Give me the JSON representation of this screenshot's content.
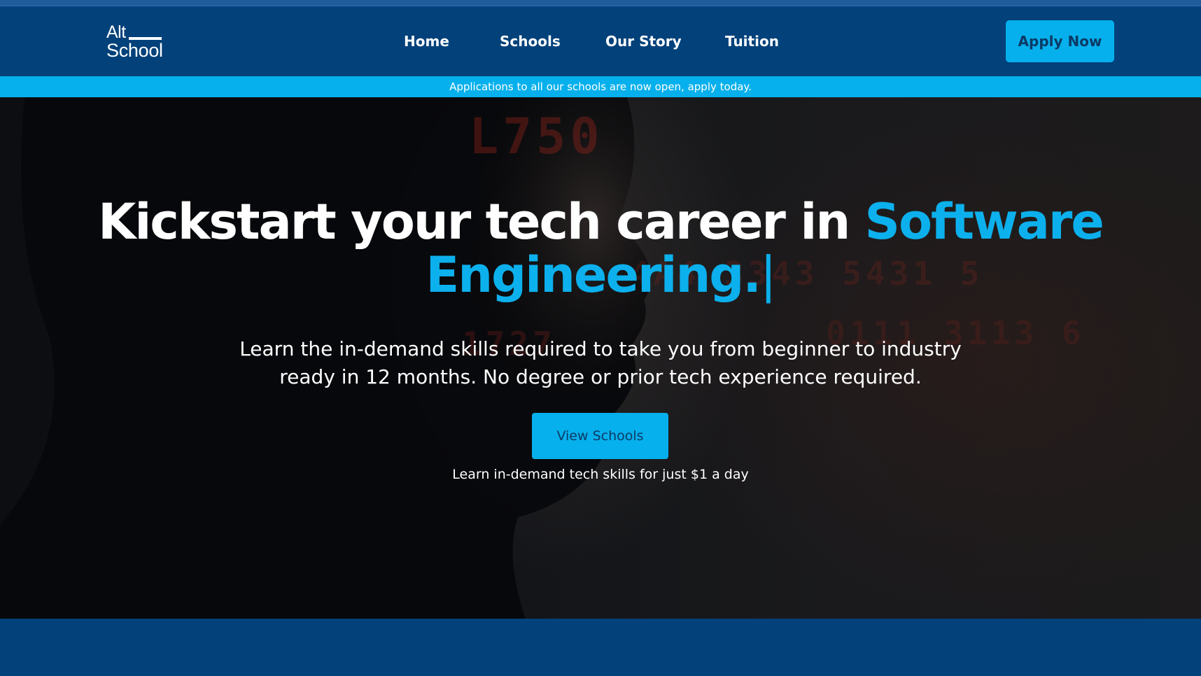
{
  "brand": {
    "logo_line1": "Alt",
    "logo_line2": "School"
  },
  "nav": {
    "items": [
      {
        "label": "Home"
      },
      {
        "label": "Schools"
      },
      {
        "label": "Our Story"
      },
      {
        "label": "Tuition"
      }
    ],
    "cta_label": "Apply Now"
  },
  "announcement": {
    "text": "Applications to all our schools are now open, apply today."
  },
  "hero": {
    "headline_prefix": "Kickstart your tech career in ",
    "headline_accent_1": "Software",
    "headline_accent_2": "Engineering.",
    "caret": "|",
    "subheading": "Learn the in-demand skills required to take you from beginner to industry ready in 12 months. No degree or prior tech experience required.",
    "button_label": "View Schools",
    "price_note": "Learn in-demand tech skills for just $1 a day"
  },
  "colors": {
    "header_bg": "#02417a",
    "accent": "#06b0ec",
    "button_text": "#0c3a66",
    "hero_text": "#ffffff"
  }
}
